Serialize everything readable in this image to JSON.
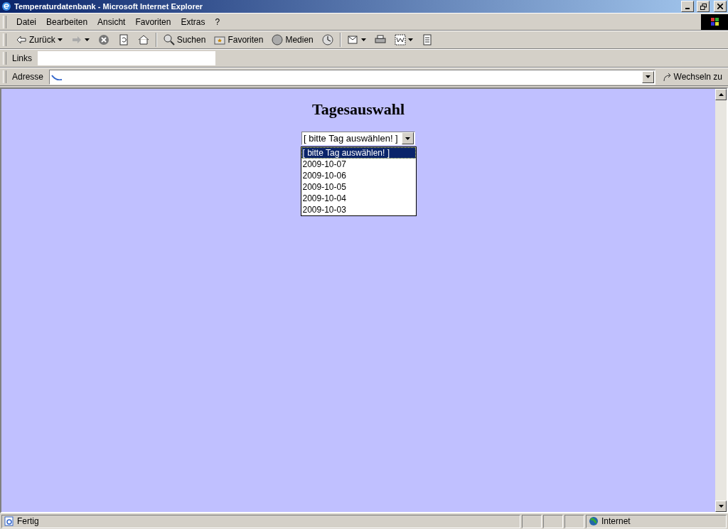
{
  "window": {
    "title": "Temperaturdatenbank - Microsoft Internet Explorer"
  },
  "menu": [
    "Datei",
    "Bearbeiten",
    "Ansicht",
    "Favoriten",
    "Extras",
    "?"
  ],
  "toolbar": [
    {
      "kind": "back",
      "label": "Zurück"
    },
    {
      "kind": "forward"
    },
    {
      "kind": "stop"
    },
    {
      "kind": "refresh"
    },
    {
      "kind": "home"
    },
    {
      "kind": "sep"
    },
    {
      "kind": "search",
      "label": "Suchen"
    },
    {
      "kind": "favorites",
      "label": "Favoriten"
    },
    {
      "kind": "media",
      "label": "Medien"
    },
    {
      "kind": "history"
    },
    {
      "kind": "sep"
    },
    {
      "kind": "mail"
    },
    {
      "kind": "print"
    },
    {
      "kind": "edit"
    },
    {
      "kind": "discuss"
    }
  ],
  "links_bar": {
    "label": "Links"
  },
  "address_bar": {
    "label": "Adresse",
    "go": "Wechseln zu"
  },
  "page": {
    "heading": "Tagesauswahl",
    "select": {
      "value": "[ bitte Tag auswählen! ]",
      "expanded": true,
      "options": [
        {
          "label": "[ bitte Tag auswählen! ]",
          "selected": true
        },
        {
          "label": "2009-10-07",
          "selected": false
        },
        {
          "label": "2009-10-06",
          "selected": false
        },
        {
          "label": "2009-10-05",
          "selected": false
        },
        {
          "label": "2009-10-04",
          "selected": false
        },
        {
          "label": "2009-10-03",
          "selected": false
        }
      ]
    }
  },
  "status_bar": {
    "text": "Fertig",
    "zone": "Internet"
  }
}
